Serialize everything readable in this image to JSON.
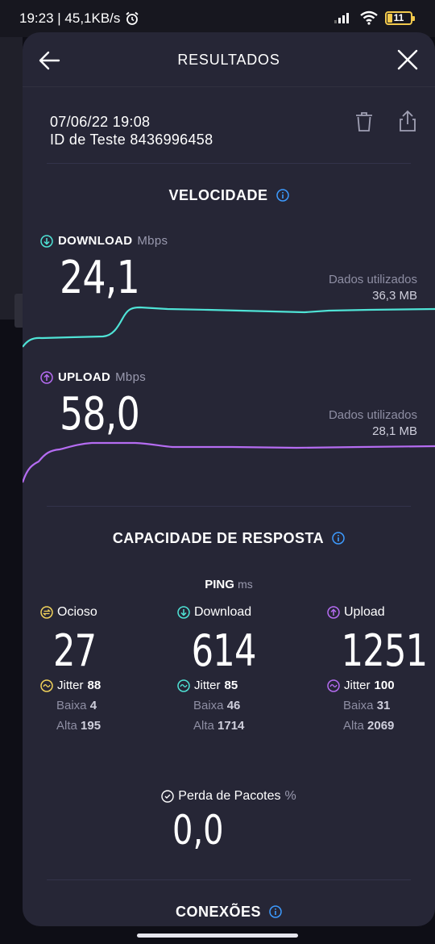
{
  "status_bar": {
    "time_speed": "19:23 | 45,1KB/s",
    "battery": "11"
  },
  "header": {
    "title": "RESULTADOS"
  },
  "result": {
    "date": "07/06/22 19:08",
    "test_id": "ID de Teste 8436996458"
  },
  "speed": {
    "section_title": "VELOCIDADE",
    "download": {
      "label": "DOWNLOAD",
      "unit": "Mbps",
      "value": "24,1",
      "data_used_label": "Dados utilizados",
      "data_used_value": "36,3 MB",
      "color": "#4fe3d6"
    },
    "upload": {
      "label": "UPLOAD",
      "unit": "Mbps",
      "value": "58,0",
      "data_used_label": "Dados utilizados",
      "data_used_value": "28,1 MB",
      "color": "#b56cf2"
    }
  },
  "responsiveness": {
    "section_title": "CAPACIDADE DE RESPOSTA",
    "ping_label": "PING",
    "ping_unit": "ms",
    "columns": [
      {
        "title": "Ocioso",
        "value": "27",
        "jitter_label": "Jitter",
        "jitter": "88",
        "low_label": "Baixa",
        "low": "4",
        "high_label": "Alta",
        "high": "195",
        "color": "#f2d35b"
      },
      {
        "title": "Download",
        "value": "614",
        "jitter_label": "Jitter",
        "jitter": "85",
        "low_label": "Baixa",
        "low": "46",
        "high_label": "Alta",
        "high": "1714",
        "color": "#4fe3d6"
      },
      {
        "title": "Upload",
        "value": "1251",
        "jitter_label": "Jitter",
        "jitter": "100",
        "low_label": "Baixa",
        "low": "31",
        "high_label": "Alta",
        "high": "2069",
        "color": "#b56cf2"
      }
    ],
    "packet_loss_label": "Perda de Pacotes",
    "packet_loss_unit": "%",
    "packet_loss_value": "0,0"
  },
  "connections": {
    "section_title": "CONEXÕES"
  }
}
